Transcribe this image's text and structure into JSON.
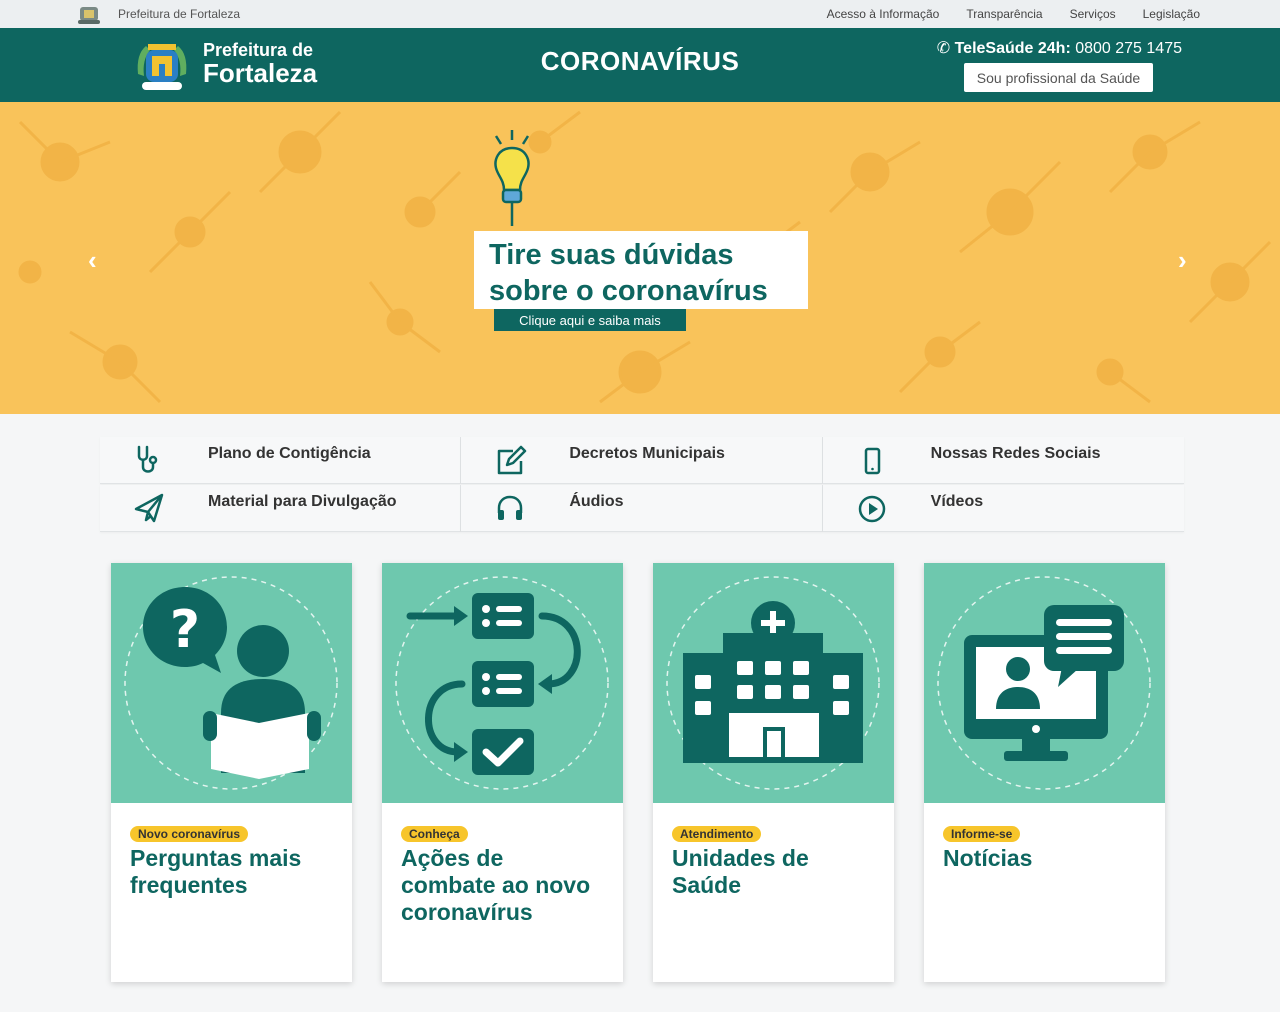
{
  "topbar": {
    "site_name": "Prefeitura de Fortaleza",
    "links": [
      "Acesso à Informação",
      "Transparência",
      "Serviços",
      "Legislação"
    ]
  },
  "header": {
    "brand_line1": "Prefeitura de",
    "brand_line2": "Fortaleza",
    "title": "CORONAVÍRUS",
    "tele_label": "TeleSaúde 24h:",
    "tele_number": "0800 275 1475",
    "pro_button": "Sou profissional da Saúde"
  },
  "hero": {
    "headline_line1": "Tire suas dúvidas",
    "headline_line2": "sobre o coronavírus",
    "cta": "Clique aqui e saiba mais",
    "prev": "‹",
    "next": "›"
  },
  "quick_links": [
    {
      "label": "Plano de Contigência",
      "icon": "stethoscope-icon"
    },
    {
      "label": "Decretos Municipais",
      "icon": "edit-document-icon"
    },
    {
      "label": "Nossas Redes Sociais",
      "icon": "smartphone-icon"
    },
    {
      "label": "Material para Divulgação",
      "icon": "paper-plane-icon"
    },
    {
      "label": "Áudios",
      "icon": "headphones-icon"
    },
    {
      "label": "Vídeos",
      "icon": "play-circle-icon"
    }
  ],
  "cards": [
    {
      "tag": "Novo coronavírus",
      "title": "Perguntas mais frequentes",
      "icon": "question-reader-icon"
    },
    {
      "tag": "Conheça",
      "title": "Ações de combate ao novo coronavírus",
      "icon": "checklist-flow-icon"
    },
    {
      "tag": "Atendimento",
      "title": "Unidades de Saúde",
      "icon": "hospital-icon"
    },
    {
      "tag": "Informe-se",
      "title": "Notícias",
      "icon": "video-chat-icon"
    }
  ],
  "colors": {
    "primary": "#0e6660",
    "hero_bg": "#f9c35a",
    "card_bg": "#6ec8ae",
    "tag_bg": "#f7c52b"
  }
}
